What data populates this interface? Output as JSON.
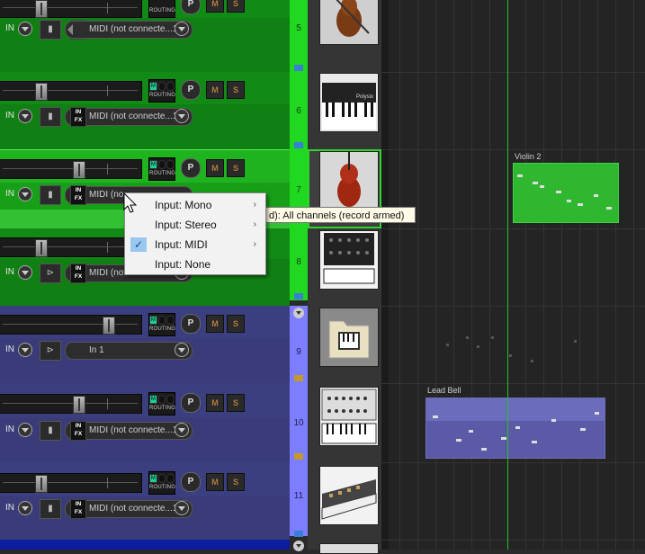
{
  "tracks": [
    {
      "number": "5",
      "input_label": "IN",
      "input": "MIDI (not connecte...1",
      "icon": "violin-icon",
      "color": "green"
    },
    {
      "number": "6",
      "input_label": "IN",
      "input": "MIDI (not connecte...1",
      "icon": "polysix-synth-icon",
      "color": "green"
    },
    {
      "number": "7",
      "input_label": "IN",
      "input": "MIDI (no",
      "icon": "cello-icon",
      "color": "green",
      "selected": true
    },
    {
      "number": "8",
      "input_label": "IN",
      "input": "MIDI (not connecte...1",
      "icon": "modular-synth-icon",
      "color": "green"
    },
    {
      "number": "9",
      "input_label": "IN",
      "input": "In 1",
      "icon": "folder-keyboard-icon",
      "color": "purple"
    },
    {
      "number": "10",
      "input_label": "IN",
      "input": "MIDI (not connecte...1",
      "icon": "analog-synth-icon",
      "color": "purple"
    },
    {
      "number": "11",
      "input_label": "IN",
      "input": "MIDI (not connecte...1",
      "icon": "polyphonic-synth-icon",
      "color": "purple"
    }
  ],
  "labels": {
    "routing": "ROUTING",
    "pan": "P",
    "mute": "M",
    "solo": "S",
    "in": "IN",
    "fx": "FX",
    "m_lamp": "M"
  },
  "context_menu": {
    "items": [
      {
        "label": "Input: Mono",
        "has_submenu": true,
        "checked": false
      },
      {
        "label": "Input: Stereo",
        "has_submenu": true,
        "checked": false
      },
      {
        "label": "Input: MIDI",
        "has_submenu": true,
        "checked": true
      },
      {
        "label": "Input: None",
        "has_submenu": false,
        "checked": false
      }
    ],
    "submenu_arrow": "›",
    "check": "✓"
  },
  "tooltip": "d): All channels (record armed)",
  "arrange": {
    "items": [
      {
        "name": "Violin 2",
        "color": "#2fb82f"
      },
      {
        "name": "Lead Bell",
        "color": "#5a5aa6"
      }
    ]
  },
  "colors": {
    "green_track": "#128a16",
    "selected_track": "#1fb41f",
    "purple_track": "#3b3f80",
    "play_cursor": "#23c323"
  }
}
